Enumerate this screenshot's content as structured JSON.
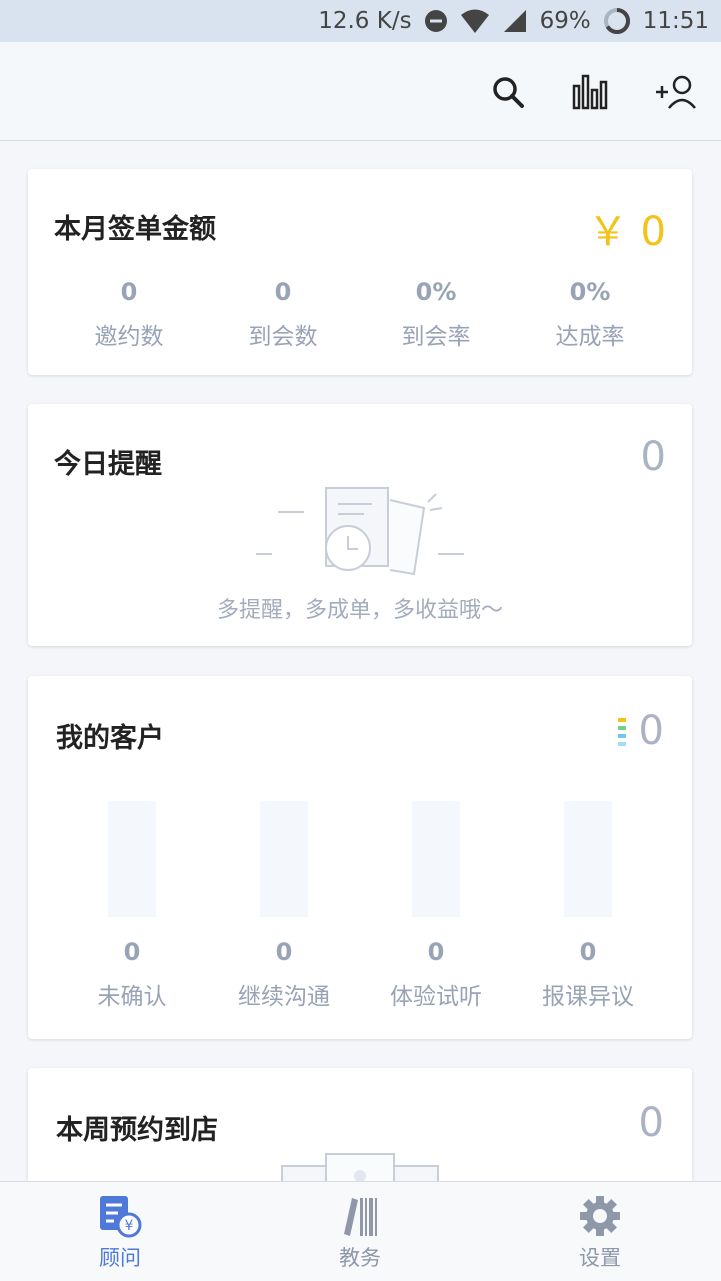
{
  "status_bar": {
    "speed": "12.6 K/s",
    "battery": "69%",
    "time": "11:51",
    "icons": [
      "dnd-icon",
      "wifi-icon",
      "signal-icon",
      "battery-ring-icon"
    ]
  },
  "app_bar": {
    "actions": [
      "search-icon",
      "statistics-icon",
      "add-user-icon"
    ]
  },
  "monthly_card": {
    "title": "本月签单金额",
    "amount": "￥ 0",
    "amount_color": "#f3c21b",
    "stats": [
      {
        "value": "0",
        "label": "邀约数"
      },
      {
        "value": "0",
        "label": "到会数"
      },
      {
        "value": "0%",
        "label": "到会率"
      },
      {
        "value": "0%",
        "label": "达成率"
      }
    ]
  },
  "reminder_card": {
    "title": "今日提醒",
    "count": "0",
    "empty_text": "多提醒，多成单，多收益哦～"
  },
  "customers_card": {
    "title": "我的客户",
    "count": "0",
    "stats": [
      {
        "value": "0",
        "label": "未确认",
        "level": 0
      },
      {
        "value": "0",
        "label": "继续沟通",
        "level": 0
      },
      {
        "value": "0",
        "label": "体验试听",
        "level": 0
      },
      {
        "value": "0",
        "label": "报课异议",
        "level": 0
      }
    ]
  },
  "weekly_card": {
    "title": "本周预约到店",
    "count": "0"
  },
  "bottom_nav": {
    "items": [
      {
        "label": "顾问",
        "icon": "consultant-icon",
        "active": true
      },
      {
        "label": "教务",
        "icon": "academic-icon",
        "active": false
      },
      {
        "label": "设置",
        "icon": "gear-icon",
        "active": false
      }
    ],
    "active_color": "#4f79d8"
  }
}
